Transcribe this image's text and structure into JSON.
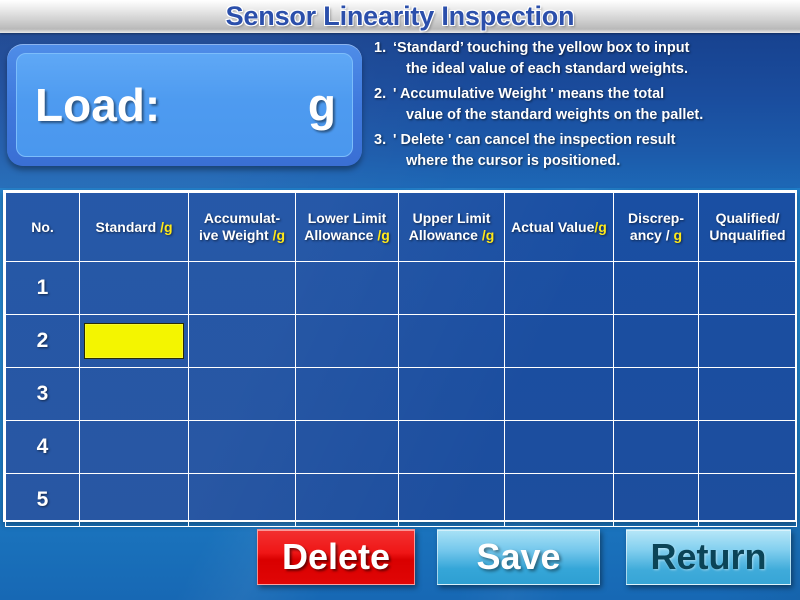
{
  "header": {
    "title": "Sensor Linearity Inspection"
  },
  "load_display": {
    "label": "Load:",
    "value": "",
    "unit": "g"
  },
  "instructions": [
    {
      "num": "1.",
      "line1": "‘Standard’   touching the yellow box to input",
      "line2": "the ideal value of each standard weights."
    },
    {
      "num": "2.",
      "line1": "' Accumulative   Weight ' means the total",
      "line2": "value of the standard weights on the pallet."
    },
    {
      "num": "3.",
      "line1": "' Delete ' can cancel the inspection result",
      "line2": "where the cursor is positioned."
    }
  ],
  "table": {
    "columns": [
      {
        "line1": "No.",
        "line2": "",
        "unit": ""
      },
      {
        "line1": "Standard ",
        "line2": "",
        "unit": "/g"
      },
      {
        "line1": "Accumulat-",
        "line2": "ive Weight ",
        "unit": "/g"
      },
      {
        "line1": "Lower Limit",
        "line2": "Allowance ",
        "unit": "/g"
      },
      {
        "line1": "Upper Limit",
        "line2": "Allowance ",
        "unit": "/g"
      },
      {
        "line1": "Actual Value",
        "line2": "",
        "unit": "/g"
      },
      {
        "line1": "Discrep-",
        "line2": "ancy / ",
        "unit": "g"
      },
      {
        "line1": "Qualified/",
        "line2": "Unqualified",
        "unit": ""
      }
    ],
    "rows": [
      {
        "no": "1",
        "standard": "",
        "accumulative": "",
        "lower_limit": "",
        "upper_limit": "",
        "actual_value": "",
        "discrepancy": "",
        "qualified": ""
      },
      {
        "no": "2",
        "standard": "",
        "accumulative": "",
        "lower_limit": "",
        "upper_limit": "",
        "actual_value": "",
        "discrepancy": "",
        "qualified": ""
      },
      {
        "no": "3",
        "standard": "",
        "accumulative": "",
        "lower_limit": "",
        "upper_limit": "",
        "actual_value": "",
        "discrepancy": "",
        "qualified": ""
      },
      {
        "no": "4",
        "standard": "",
        "accumulative": "",
        "lower_limit": "",
        "upper_limit": "",
        "actual_value": "",
        "discrepancy": "",
        "qualified": ""
      },
      {
        "no": "5",
        "standard": "",
        "accumulative": "",
        "lower_limit": "",
        "upper_limit": "",
        "actual_value": "",
        "discrepancy": "",
        "qualified": ""
      }
    ],
    "active_cell": {
      "row": "2",
      "column": "Standard"
    }
  },
  "buttons": {
    "delete": "Delete",
    "save": "Save",
    "return": "Return"
  },
  "colors": {
    "title_blue": "#2b4fab",
    "panel_blue": "#1a4fa3",
    "background_blue": "#1d79c6",
    "unit_yellow": "#ffe919",
    "active_cell_yellow": "#f4f500",
    "delete_red": "#ef1616",
    "button_cyan": "#74c7ec",
    "return_text_teal": "#0b4457"
  }
}
